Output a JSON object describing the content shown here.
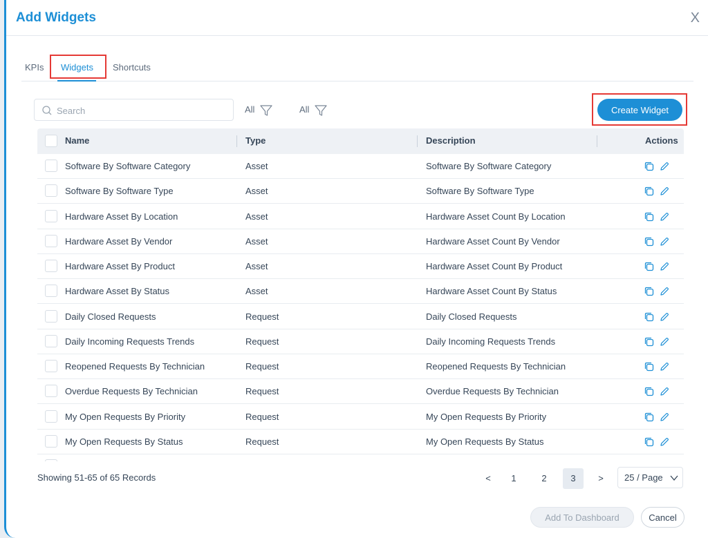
{
  "dialog": {
    "title": "Add Widgets",
    "close_glyph": "X"
  },
  "tabs": [
    {
      "label": "KPIs",
      "active": false
    },
    {
      "label": "Widgets",
      "active": true
    },
    {
      "label": "Shortcuts",
      "active": false
    }
  ],
  "search": {
    "placeholder": "Search",
    "value": ""
  },
  "filters": [
    {
      "label": "All"
    },
    {
      "label": "All"
    }
  ],
  "create_button": "Create Widget",
  "table": {
    "columns": {
      "name": "Name",
      "type": "Type",
      "description": "Description",
      "actions": "Actions"
    },
    "rows": [
      {
        "name": "Software By Software Category",
        "type": "Asset",
        "description": "Software By Software Category"
      },
      {
        "name": "Software By Software Type",
        "type": "Asset",
        "description": "Software By Software Type"
      },
      {
        "name": "Hardware Asset By Location",
        "type": "Asset",
        "description": "Hardware Asset Count By Location"
      },
      {
        "name": "Hardware Asset By Vendor",
        "type": "Asset",
        "description": "Hardware Asset Count By Vendor"
      },
      {
        "name": "Hardware Asset By Product",
        "type": "Asset",
        "description": "Hardware Asset Count By Product"
      },
      {
        "name": "Hardware Asset By Status",
        "type": "Asset",
        "description": "Hardware Asset Count By Status"
      },
      {
        "name": "Daily Closed Requests",
        "type": "Request",
        "description": "Daily Closed Requests"
      },
      {
        "name": "Daily Incoming Requests Trends",
        "type": "Request",
        "description": "Daily Incoming Requests Trends"
      },
      {
        "name": "Reopened Requests By Technician",
        "type": "Request",
        "description": "Reopened Requests By Technician"
      },
      {
        "name": "Overdue Requests By Technician",
        "type": "Request",
        "description": "Overdue Requests By Technician"
      },
      {
        "name": "My Open Requests By Priority",
        "type": "Request",
        "description": "My Open Requests By Priority"
      },
      {
        "name": "My Open Requests By Status",
        "type": "Request",
        "description": "My Open Requests By Status"
      }
    ],
    "action_icons": [
      "copy-icon",
      "edit-pencil-icon"
    ]
  },
  "footer": {
    "records_text": "Showing 51-65 of 65 Records",
    "pagination": {
      "prev": "<",
      "pages": [
        "1",
        "2",
        "3"
      ],
      "current": "3",
      "next": ">"
    },
    "page_size": "25 / Page"
  },
  "buttons": {
    "add_to_dashboard": "Add To Dashboard",
    "cancel": "Cancel"
  },
  "colors": {
    "accent": "#1d8fd6",
    "highlight": "#e53935"
  }
}
